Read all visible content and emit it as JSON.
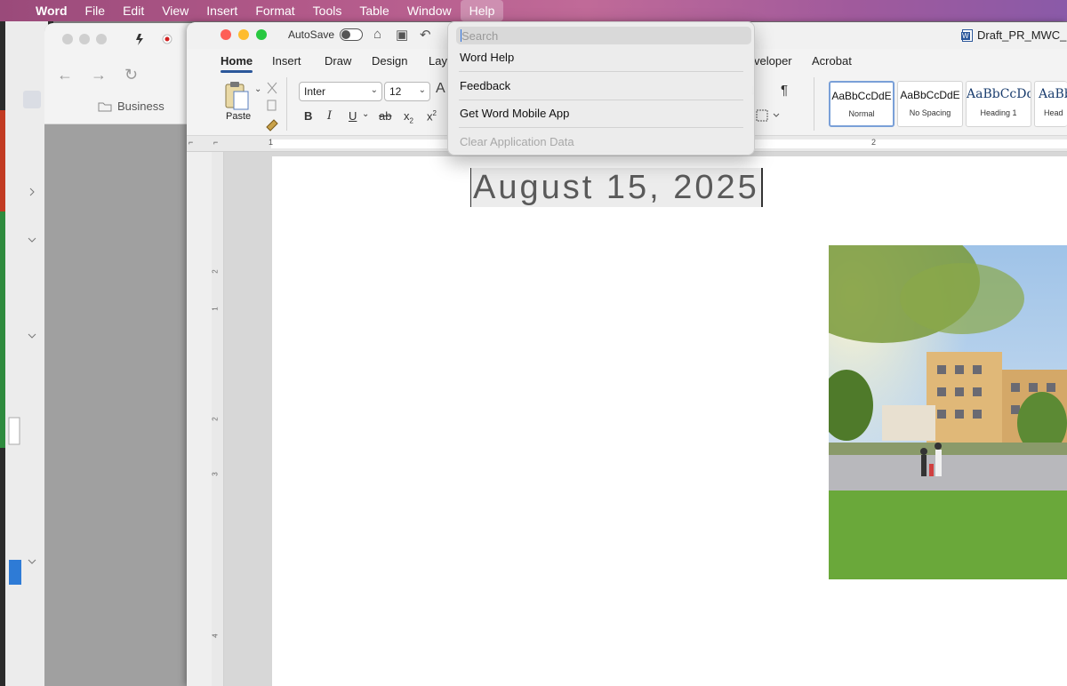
{
  "menubar": {
    "app_name": "Word",
    "items": [
      "File",
      "Edit",
      "View",
      "Insert",
      "Format",
      "Tools",
      "Table",
      "Window",
      "Help"
    ],
    "active": "Help"
  },
  "help_menu": {
    "search_placeholder": "Search",
    "items": [
      {
        "label": "Word Help",
        "enabled": true
      },
      {
        "label": "Feedback",
        "enabled": true
      },
      {
        "label": "Get Word Mobile App",
        "enabled": true
      },
      {
        "label": "Clear Application Data",
        "enabled": false
      }
    ]
  },
  "browser": {
    "bookmark": "Business"
  },
  "word": {
    "autosave_label": "AutoSave",
    "doc_title": "Draft_PR_MWC_C",
    "tabs": [
      "Home",
      "Insert",
      "Draw",
      "Design",
      "Lay",
      "veloper",
      "Acrobat"
    ],
    "active_tab": "Home",
    "ribbon": {
      "paste_label": "Paste",
      "font_name": "Inter",
      "font_size": "12",
      "styles": [
        {
          "sample": "AaBbCcDdE",
          "name": "Normal"
        },
        {
          "sample": "AaBbCcDdE",
          "name": "No Spacing"
        },
        {
          "sample": "AaBbCcDd",
          "name": "Heading 1"
        },
        {
          "sample": "AaBb",
          "name": "Head"
        }
      ]
    },
    "document": {
      "date_text": "August 15, 2025"
    }
  },
  "colors": {
    "word_blue": "#2b579a",
    "close": "#fe5f57",
    "minimize": "#febc2e",
    "zoom": "#28c840"
  }
}
